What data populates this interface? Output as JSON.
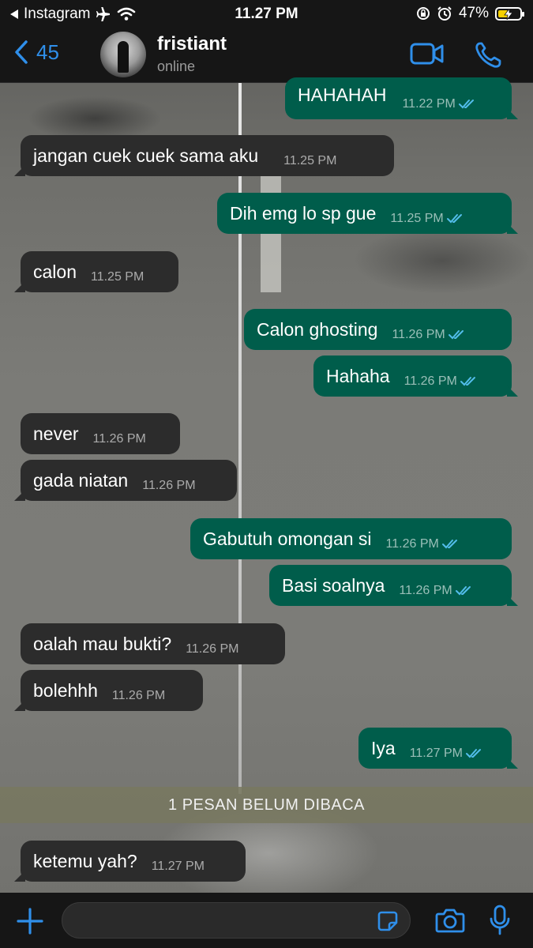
{
  "status_bar": {
    "back_app": "Instagram",
    "time": "11.27 PM",
    "battery": "47%",
    "battery_level": 0.47
  },
  "header": {
    "back_count": "45",
    "contact_name": "fristiant",
    "contact_status": "online"
  },
  "messages": [
    {
      "dir": "out",
      "text": "HAHAHAH",
      "time": "11.22 PM"
    },
    {
      "dir": "in",
      "text": "jangan cuek cuek sama aku",
      "time": "11.25 PM"
    },
    {
      "dir": "out",
      "text": "Dih emg lo sp gue",
      "time": "11.25 PM"
    },
    {
      "dir": "in",
      "text": "calon",
      "time": "11.25 PM"
    },
    {
      "dir": "out",
      "text": "Calon ghosting",
      "time": "11.26 PM"
    },
    {
      "dir": "out",
      "text": "Hahaha",
      "time": "11.26 PM"
    },
    {
      "dir": "in",
      "text": "never",
      "time": "11.26 PM"
    },
    {
      "dir": "in",
      "text": "gada niatan",
      "time": "11.26 PM"
    },
    {
      "dir": "out",
      "text": "Gabutuh omongan si",
      "time": "11.26 PM"
    },
    {
      "dir": "out",
      "text": "Basi soalnya",
      "time": "11.26 PM"
    },
    {
      "dir": "in",
      "text": "oalah mau bukti?",
      "time": "11.26 PM"
    },
    {
      "dir": "in",
      "text": "bolehhh",
      "time": "11.26 PM"
    },
    {
      "dir": "out",
      "text": "Iya",
      "time": "11.27 PM"
    },
    {
      "dir": "in",
      "text": "ketemu yah?",
      "time": "11.27 PM"
    }
  ],
  "unread_banner": "1 PESAN BELUM DIBACA",
  "colors": {
    "accent": "#2f8fea",
    "outgoing_bubble": "#005d4b",
    "incoming_bubble": "#2c2c2c",
    "read_ticks": "#53bdeb"
  }
}
